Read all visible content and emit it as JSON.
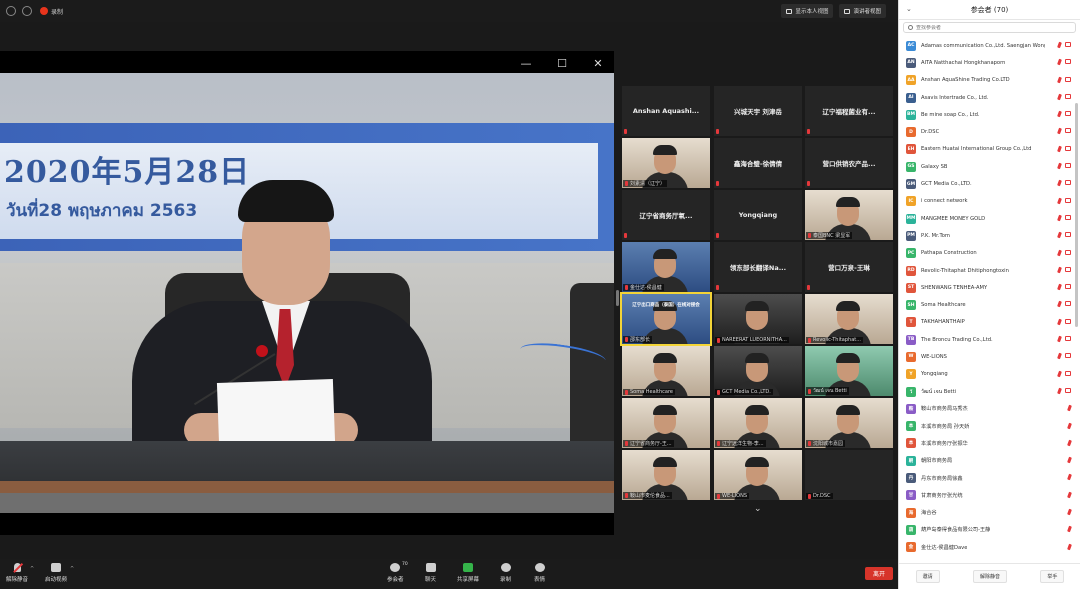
{
  "topbar": {
    "recording_label": "录制",
    "btn_show_self": "显示本人视图",
    "btn_gallery": "演讲者视图"
  },
  "window_controls": {
    "minimize": "—",
    "maximize": "☐",
    "close": "✕"
  },
  "main_video": {
    "banner_date": "2020年5月28日",
    "banner_thai": "วันที่28 พฤษภาคม 2563"
  },
  "gallery": {
    "tiles": [
      {
        "name": "Anshan Aquashi...",
        "label": ""
      },
      {
        "name": "兴城天宇 刘津岳",
        "label": ""
      },
      {
        "name": "辽宁福程菌业有...",
        "label": ""
      },
      {
        "name": "",
        "label": "刘素清（辽宁）"
      },
      {
        "name": "鑫海合璧-徐倩倩",
        "label": ""
      },
      {
        "name": "营口供销农产品...",
        "label": ""
      },
      {
        "name": "辽宁省商务厅氧...",
        "label": ""
      },
      {
        "name": "Yongqiang",
        "label": ""
      },
      {
        "name": "",
        "label": "泰国BNC 梁显军"
      },
      {
        "name": "",
        "label": "金仕达-侯昌健"
      },
      {
        "name": "领东部长翻译Na...",
        "label": ""
      },
      {
        "name": "营口万泉-王琳",
        "label": ""
      },
      {
        "name": "",
        "label": "邵东部长",
        "banner": "辽宁出口商品（泰国）在线对接会"
      },
      {
        "name": "",
        "label": "NAREERAT LUEORNITHA..."
      },
      {
        "name": "",
        "label": "Revolic-Thitaphat..."
      },
      {
        "name": "",
        "label": "Soma Healthcare"
      },
      {
        "name": "",
        "label": "GCT Media Co.,LTD."
      },
      {
        "name": "",
        "label": "วัฒน์ เจน Betti"
      },
      {
        "name": "",
        "label": "辽宁省商务厅-王..."
      },
      {
        "name": "",
        "label": "辽宁远洋生物-李..."
      },
      {
        "name": "",
        "label": "沈阳城市嘉园"
      },
      {
        "name": "",
        "label": "鞍山市麦伦食品..."
      },
      {
        "name": "",
        "label": "WE-LIONS"
      },
      {
        "name": "",
        "label": "Dr.DSC"
      }
    ],
    "chevron": "⌄"
  },
  "bottombar": {
    "mute": "解除静音",
    "video": "启动视频",
    "participants": "参会者",
    "participants_count": "70",
    "chat": "聊天",
    "share": "共享屏幕",
    "record": "录制",
    "reactions": "表情",
    "end": "离开"
  },
  "panel": {
    "title": "参会者 (70)",
    "search_placeholder": "查找参会者",
    "participants": [
      {
        "initials": "AC",
        "name": "Adamas communication Co.,Ltd. Saengjan Wongthong",
        "color": "#3b8bd6"
      },
      {
        "initials": "AN",
        "name": "AITA Natthachai Hongkhanaporn",
        "color": "#4a5b7a"
      },
      {
        "initials": "AA",
        "name": "Anshan AquaShine Trading Co.LTD",
        "color": "#f0a328"
      },
      {
        "initials": "AI",
        "name": "Asavis Intertrade Co., Ltd.",
        "color": "#3a5f8f"
      },
      {
        "initials": "BM",
        "name": "Be mine soap Co., Ltd.",
        "color": "#2bb39a"
      },
      {
        "initials": "D",
        "name": "Dr.DSC",
        "color": "#e86a2e"
      },
      {
        "initials": "EH",
        "name": "Eastern Huatai International Group Co.,Ltd",
        "color": "#e0553b"
      },
      {
        "initials": "GS",
        "name": "Galaxy SB",
        "color": "#38b56a"
      },
      {
        "initials": "GM",
        "name": "GCT Media Co.,LTD.",
        "color": "#4a5b7a"
      },
      {
        "initials": "IC",
        "name": "i connect network",
        "color": "#f0a328"
      },
      {
        "initials": "MM",
        "name": "MANGMEE MONEY GOLD",
        "color": "#2bb39a"
      },
      {
        "initials": "PM",
        "name": "P.K. Mr.Tom",
        "color": "#4a5b7a"
      },
      {
        "initials": "PC",
        "name": "Pathapa Construction",
        "color": "#38b56a"
      },
      {
        "initials": "RD",
        "name": "Revolic-Thitaphat Dhitiphongtoxin",
        "color": "#e0553b"
      },
      {
        "initials": "ST",
        "name": "SHENWANG TENHEA-AMY",
        "color": "#e0553b"
      },
      {
        "initials": "SH",
        "name": "Soma Healthcare",
        "color": "#38b56a"
      },
      {
        "initials": "T",
        "name": "TAKHAHANTHAIP",
        "color": "#e0553b"
      },
      {
        "initials": "TB",
        "name": "The Broncu Trading Co.,Ltd.",
        "color": "#8a5cc6"
      },
      {
        "initials": "W",
        "name": "WE-LIONS",
        "color": "#e86a2e"
      },
      {
        "initials": "Y",
        "name": "Yongqiang",
        "color": "#f0a328"
      },
      {
        "initials": "วั",
        "name": "วัฒน์ เจน Betti",
        "color": "#38b56a"
      },
      {
        "initials": "鞍",
        "name": "鞍山市商务局马秀杰",
        "color": "#8a5cc6"
      },
      {
        "initials": "本",
        "name": "本溪市商务局 孙天娇",
        "color": "#38b56a"
      },
      {
        "initials": "本",
        "name": "本溪市商务厅张振华",
        "color": "#e0553b"
      },
      {
        "initials": "朝",
        "name": "朝阳市商务局",
        "color": "#2bb39a"
      },
      {
        "initials": "丹",
        "name": "丹东市商务局徐鑫",
        "color": "#4a5b7a"
      },
      {
        "initials": "甘",
        "name": "甘肃商务厅张光统",
        "color": "#8a5cc6"
      },
      {
        "initials": "海",
        "name": "海合谷",
        "color": "#e86a2e"
      },
      {
        "initials": "葫",
        "name": "葫芦岛泰得食品有限公司-王静",
        "color": "#38b56a"
      },
      {
        "initials": "金",
        "name": "金仕达-侯昌健Dave",
        "color": "#e86a2e"
      }
    ],
    "footer": {
      "invite": "邀请",
      "unmute_all": "解除静音",
      "raise_hand": "举手"
    }
  }
}
